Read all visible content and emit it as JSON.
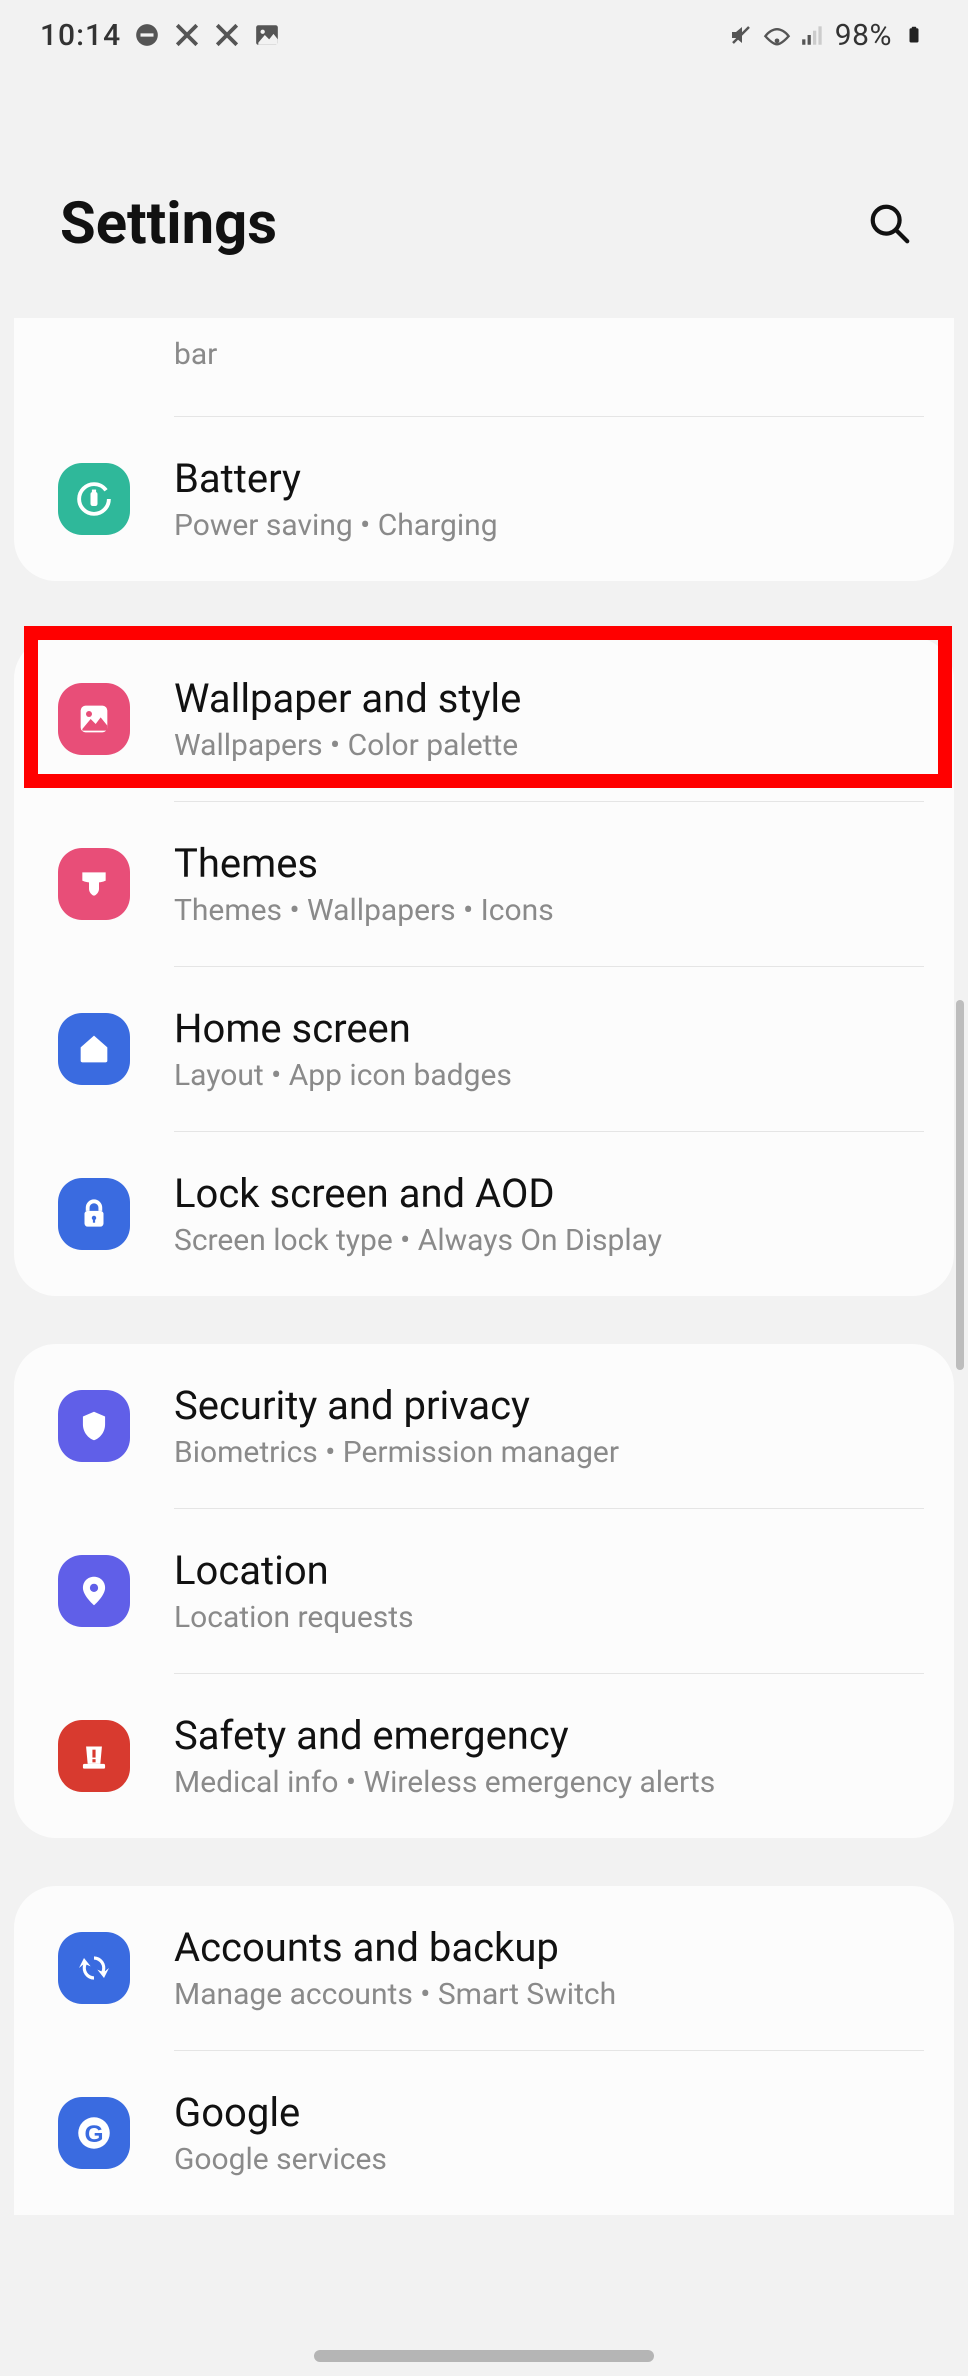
{
  "status": {
    "time": "10:14",
    "battery": "98%"
  },
  "header": {
    "title": "Settings"
  },
  "partial": {
    "sub": "bar"
  },
  "rows": {
    "battery": {
      "title": "Battery",
      "sub": "Power saving  •  Charging"
    },
    "wallpaper": {
      "title": "Wallpaper and style",
      "sub": "Wallpapers  •  Color palette"
    },
    "themes": {
      "title": "Themes",
      "sub": "Themes  •  Wallpapers  •  Icons"
    },
    "home": {
      "title": "Home screen",
      "sub": "Layout  •  App icon badges"
    },
    "lock": {
      "title": "Lock screen and AOD",
      "sub": "Screen lock type  •  Always On Display"
    },
    "security": {
      "title": "Security and privacy",
      "sub": "Biometrics  •  Permission manager"
    },
    "location": {
      "title": "Location",
      "sub": "Location requests"
    },
    "safety": {
      "title": "Safety and emergency",
      "sub": "Medical info  •  Wireless emergency alerts"
    },
    "accounts": {
      "title": "Accounts and backup",
      "sub": "Manage accounts  •  Smart Switch"
    },
    "google": {
      "title": "Google",
      "sub": "Google services"
    }
  }
}
